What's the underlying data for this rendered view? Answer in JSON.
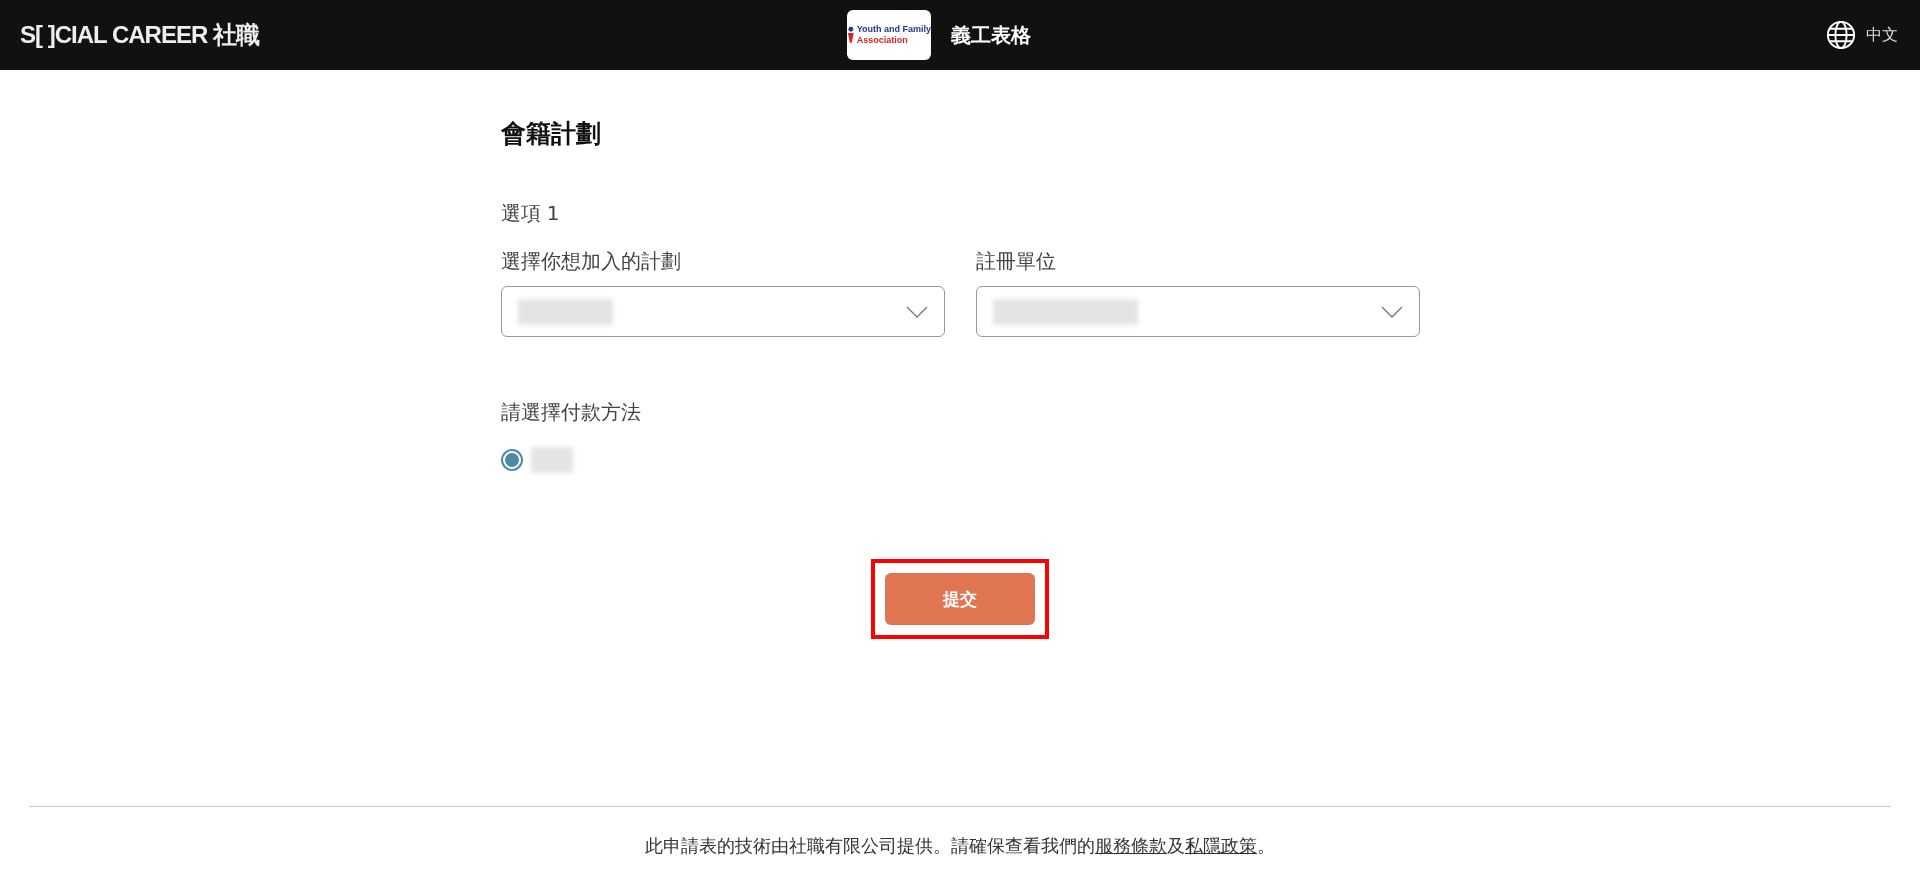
{
  "header": {
    "brand": "S[ ]CIAL CAREER 社職",
    "org_logo": {
      "line_1": "Youth and Family",
      "line_2": "Association"
    },
    "form_title": "義工表格",
    "language": "中文"
  },
  "section_title": "會籍計劃",
  "option_label": "選項 1",
  "fields": [
    {
      "label": "選擇你想加入的計劃",
      "kind": "select"
    },
    {
      "label": "註冊單位",
      "kind": "select"
    }
  ],
  "payment": {
    "label": "請選擇付款方法",
    "options": [
      {
        "selected": true
      }
    ]
  },
  "submit": {
    "label": "提交",
    "highlighted": true
  },
  "footer": {
    "text_before": "此申請表的技術由社職有限公司提供。請確保查看我們的",
    "terms_link": "服務條款",
    "between": "及",
    "privacy_link": "私隱政策",
    "after": "。"
  }
}
